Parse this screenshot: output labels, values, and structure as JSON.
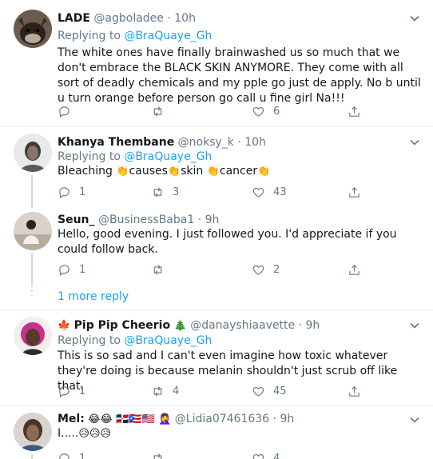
{
  "tweets": [
    {
      "name": "LADE",
      "handle": "@agboladee",
      "time": "10h",
      "replying_prefix": "Replying to ",
      "replying_to": "@BraQuaye_Gh",
      "body": "The white ones have finally brainwashed us so much that we don't embrace the BLACK SKIN ANYMORE. They come with all sort of deadly chemicals and my pple go just de apply. No b until u turn orange before person go call u fine girl Na!!!",
      "reply_count": "",
      "retweet_count": "",
      "like_count": "6"
    },
    {
      "name": "Khanya Thembane",
      "handle": "@noksy_k",
      "time": "10h",
      "replying_prefix": "Replying to ",
      "replying_to": "@BraQuaye_Gh",
      "body_parts": [
        "Bleaching ",
        "causes",
        "skin ",
        "cancer"
      ],
      "reply_count": "1",
      "retweet_count": "3",
      "like_count": "43"
    },
    {
      "name": "Seun_",
      "handle": "@BusinessBaba1",
      "time": "9h",
      "body": "Hello, good evening. I just followed you. I'd appreciate if you could follow back.",
      "reply_count": "1",
      "retweet_count": "",
      "like_count": "2"
    },
    {
      "name": "Pip Pip Cheerio",
      "handle": "@danayshiaavette",
      "time": "9h",
      "replying_prefix": "Replying to ",
      "replying_to": "@BraQuaye_Gh",
      "body": "This is so sad and I can't even imagine how toxic whatever they're doing is because melanin shouldn't just scrub off like that.",
      "reply_count": "1",
      "retweet_count": "4",
      "like_count": "45"
    },
    {
      "name": "Mel:",
      "handle": "@Lidia07461636",
      "time": "9h",
      "body": "I.....",
      "reply_count": "1",
      "retweet_count": "",
      "like_count": "4"
    }
  ],
  "more_replies_label": "1 more reply",
  "colors": {
    "accent": "#1da1f2",
    "secondary_text": "#657786",
    "divider": "#e6ecf0",
    "thread_line": "#ccd6dd"
  },
  "icons": [
    "reply-icon",
    "retweet-icon",
    "like-icon",
    "share-icon",
    "chevron-down-icon",
    "clap-emoji",
    "laughing-emoji",
    "flag-emoji",
    "crying-emoji",
    "maple-leaf-emoji",
    "christmas-tree-emoji"
  ]
}
